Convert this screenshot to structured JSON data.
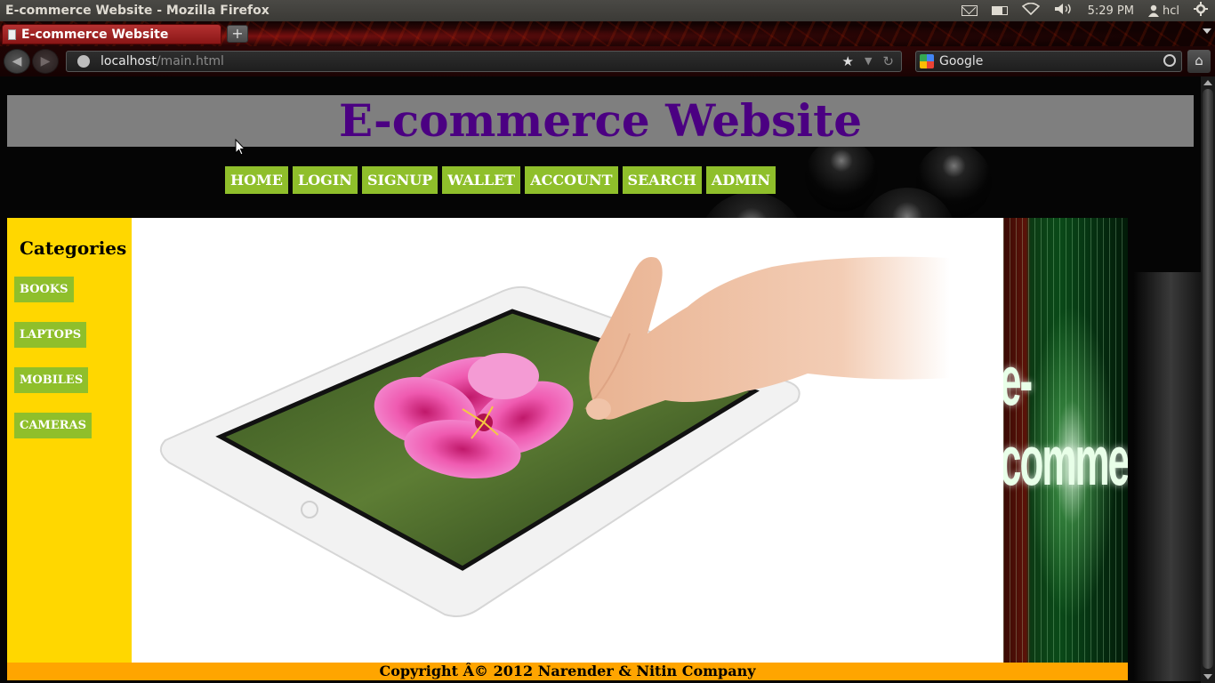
{
  "os": {
    "window_title": "E-commerce Website - Mozilla Firefox",
    "time": "5:29 PM",
    "user": "hcl",
    "icons": [
      "mail-icon",
      "battery-icon",
      "wifi-icon",
      "volume-icon",
      "user-icon",
      "gear-icon"
    ]
  },
  "browser": {
    "tab_title": "E-commerce Website",
    "new_tab_symbol": "+",
    "url_host": "localhost",
    "url_path": "/main.html",
    "search_placeholder": "Google",
    "back_symbol": "◀",
    "forward_symbol": "▶",
    "home_symbol": "⌂",
    "star_symbol": "★",
    "dropdown_symbol": "▼",
    "reload_symbol": "↻"
  },
  "site": {
    "title": "E-commerce Website",
    "menu": [
      "HOME",
      "LOGIN",
      "SIGNUP",
      "WALLET",
      "ACCOUNT",
      "SEARCH",
      "ADMIN"
    ],
    "categories_heading": "Categories",
    "categories": [
      "BOOKS",
      "LAPTOPS",
      "MOBILES",
      "CAMERAS"
    ],
    "banner_text": "e-commerce",
    "copyright": "Copyright Â© 2012 Narender & Nitin Company"
  },
  "colors": {
    "title": "#4b0082",
    "header_band": "#7f7f7f",
    "menu_button": "#8fbf2b",
    "sidebar": "#ffd700",
    "footer": "#ffa500"
  }
}
